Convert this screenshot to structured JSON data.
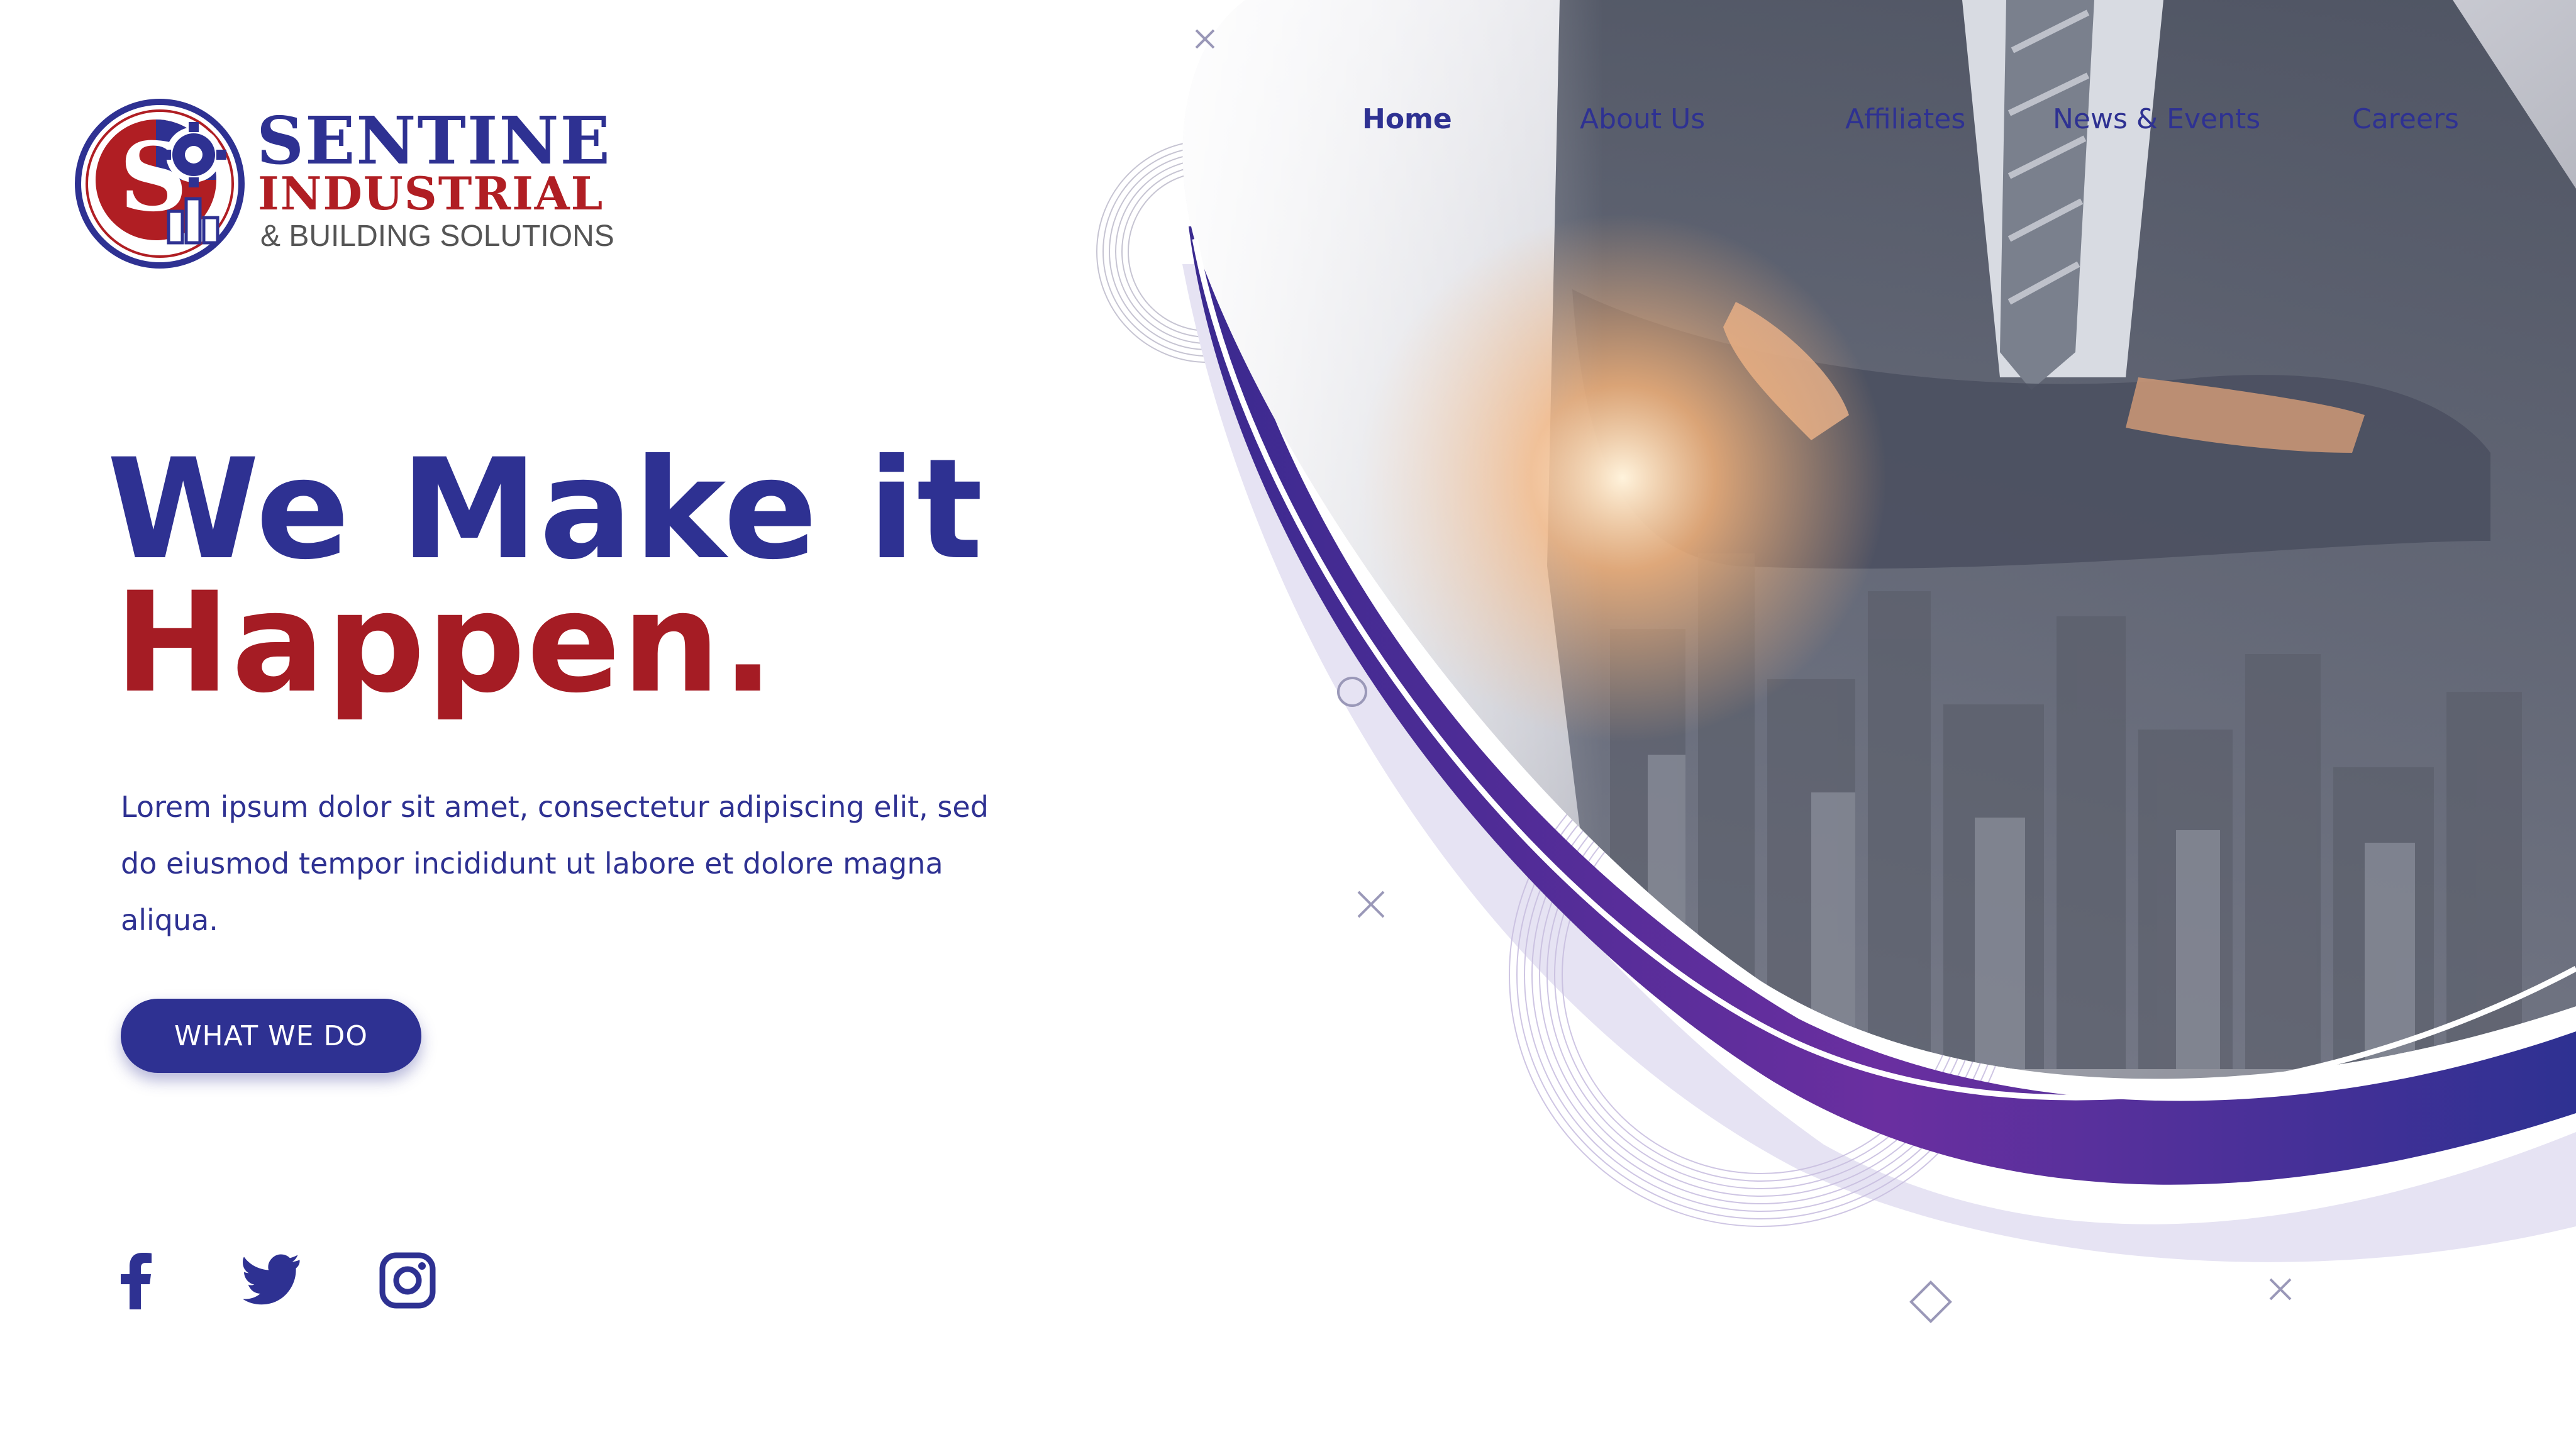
{
  "brand": {
    "line1": "SENTINE",
    "line2": "INDUSTRIAL",
    "line3": "& BUILDING SOLUTIONS",
    "monogram": "S",
    "colors": {
      "primary": "#2e3192",
      "accent": "#a51c24",
      "purple": "#5b2a96",
      "lavender": "#e6e3f3"
    }
  },
  "nav": {
    "items": [
      {
        "label": "Home",
        "active": true
      },
      {
        "label": "About Us",
        "active": false
      },
      {
        "label": "Affiliates",
        "active": false
      },
      {
        "label": "News & Events",
        "active": false
      },
      {
        "label": "Careers",
        "active": false
      }
    ]
  },
  "hero": {
    "title_line1": "We Make it",
    "title_line2": "Happen.",
    "description": "Lorem ipsum dolor sit amet, consectetur adipiscing elit, sed do eiusmod tempor incididunt ut labore et dolore magna aliqua.",
    "cta_label": "WHAT WE DO"
  },
  "social": {
    "icons": [
      "facebook-icon",
      "twitter-icon",
      "instagram-icon"
    ]
  }
}
